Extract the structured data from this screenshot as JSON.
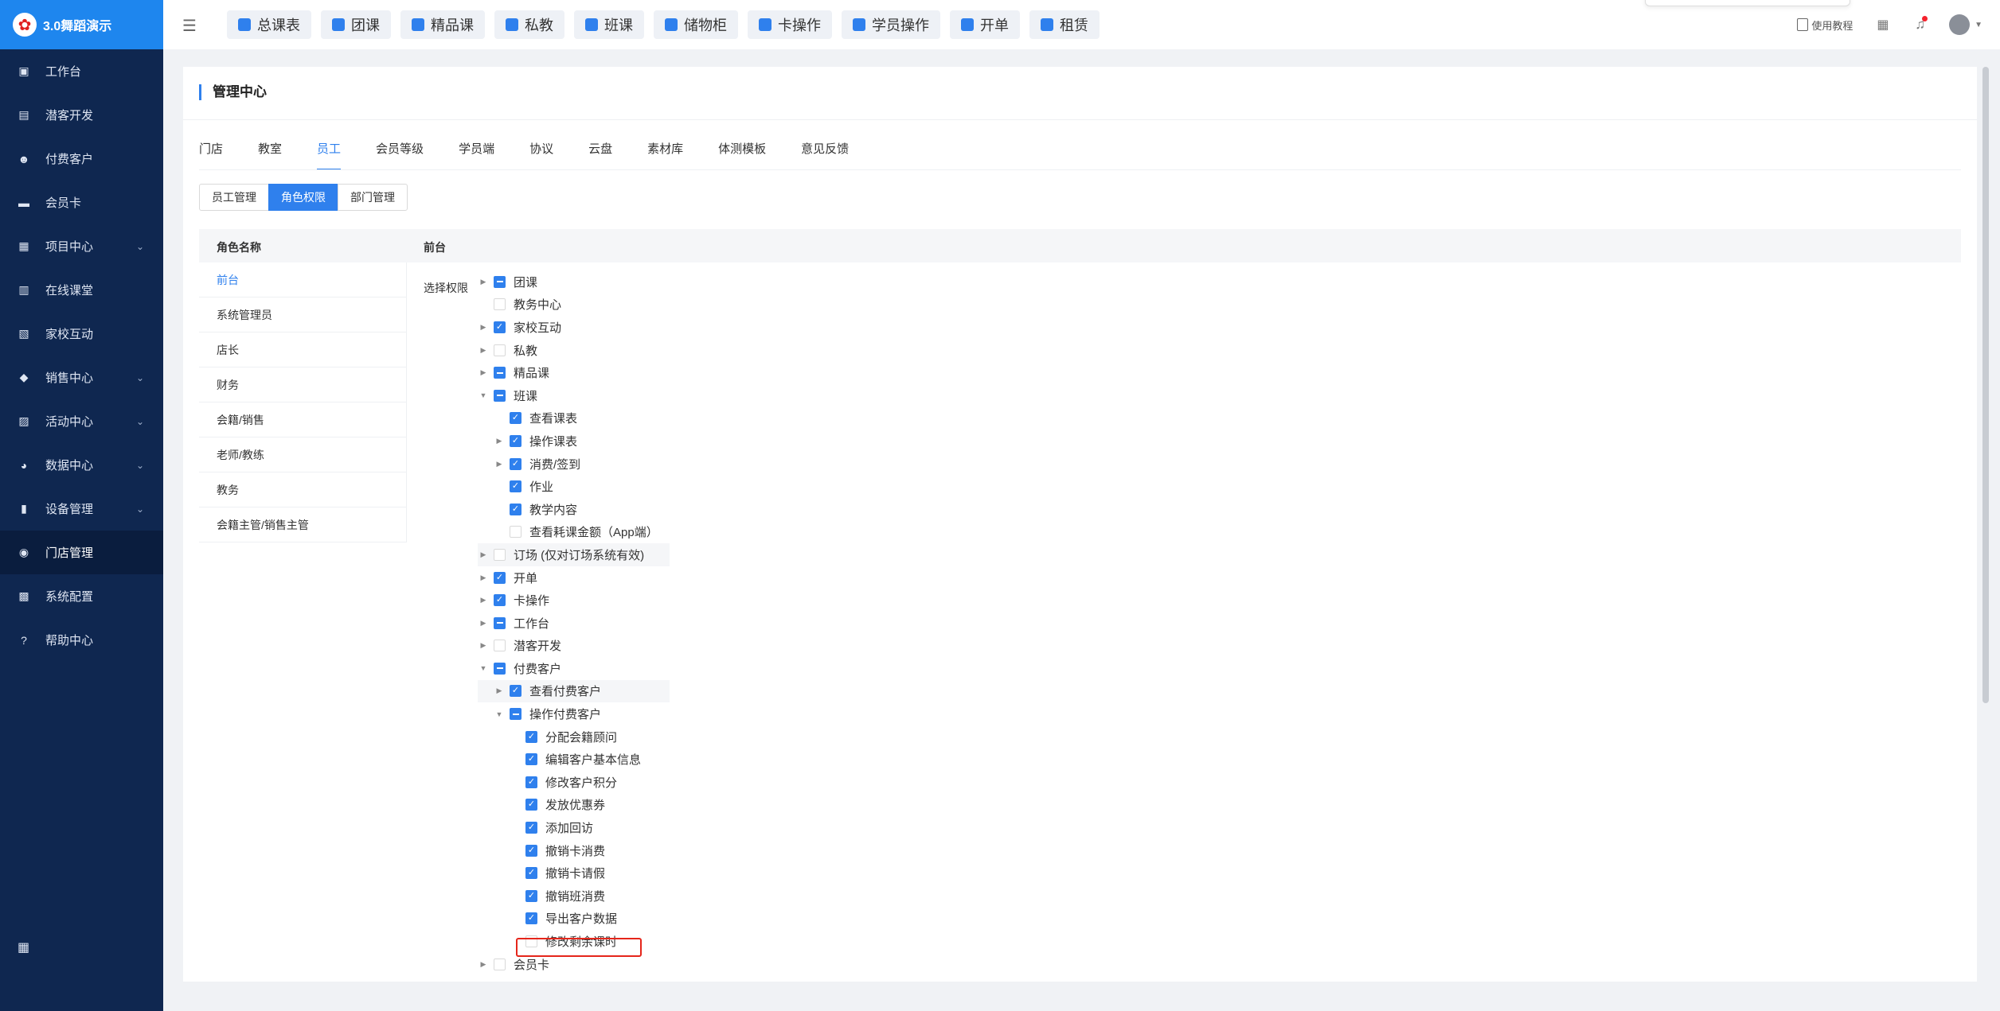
{
  "sidebar": {
    "brand": "3.0舞蹈演示",
    "items": [
      {
        "label": "工作台",
        "icon": "dashboard-icon",
        "glyph": "▣",
        "chev": false,
        "active": false
      },
      {
        "label": "潜客开发",
        "icon": "prospect-icon",
        "glyph": "▤",
        "chev": false,
        "active": false
      },
      {
        "label": "付费客户",
        "icon": "customers-icon",
        "glyph": "☻",
        "chev": false,
        "active": false
      },
      {
        "label": "会员卡",
        "icon": "card-icon",
        "glyph": "▬",
        "chev": false,
        "active": false
      },
      {
        "label": "项目中心",
        "icon": "project-icon",
        "glyph": "▦",
        "chev": true,
        "active": false
      },
      {
        "label": "在线课堂",
        "icon": "classroom-icon",
        "glyph": "▥",
        "chev": false,
        "active": false
      },
      {
        "label": "家校互动",
        "icon": "interaction-icon",
        "glyph": "▧",
        "chev": false,
        "active": false
      },
      {
        "label": "销售中心",
        "icon": "sales-icon",
        "glyph": "◆",
        "chev": true,
        "active": false
      },
      {
        "label": "活动中心",
        "icon": "activity-icon",
        "glyph": "▨",
        "chev": true,
        "active": false
      },
      {
        "label": "数据中心",
        "icon": "data-icon",
        "glyph": "◕",
        "chev": true,
        "active": false
      },
      {
        "label": "设备管理",
        "icon": "device-icon",
        "glyph": "▮",
        "chev": true,
        "active": false
      },
      {
        "label": "门店管理",
        "icon": "store-icon",
        "glyph": "◉",
        "chev": false,
        "active": true
      },
      {
        "label": "系统配置",
        "icon": "settings-icon",
        "glyph": "▩",
        "chev": false,
        "active": false
      },
      {
        "label": "帮助中心",
        "icon": "help-icon",
        "glyph": "?",
        "chev": false,
        "active": false
      }
    ],
    "bottom_icon": "apps-icon"
  },
  "topbar": {
    "quick": [
      "总课表",
      "团课",
      "精品课",
      "私教",
      "班课",
      "储物柜",
      "卡操作",
      "学员操作",
      "开单",
      "租赁"
    ],
    "help": "使用教程"
  },
  "card": {
    "title": "管理中心",
    "tabs": [
      "门店",
      "教室",
      "员工",
      "会员等级",
      "学员端",
      "协议",
      "云盘",
      "素材库",
      "体测模板",
      "意见反馈"
    ],
    "active_tab": 2,
    "segments": [
      "员工管理",
      "角色权限",
      "部门管理"
    ],
    "active_segment": 1
  },
  "roles": {
    "col1": "角色名称",
    "col2": "前台",
    "list": [
      "前台",
      "系统管理员",
      "店长",
      "财务",
      "会籍/销售",
      "老师/教练",
      "教务",
      "会籍主管/销售主管"
    ],
    "active": 0
  },
  "permissions": {
    "label": "选择权限",
    "tree": [
      {
        "label": "团课",
        "level": 0,
        "caret": "right",
        "state": "indet"
      },
      {
        "label": "教务中心",
        "level": 0,
        "caret": "none",
        "state": "off"
      },
      {
        "label": "家校互动",
        "level": 0,
        "caret": "right",
        "state": "on"
      },
      {
        "label": "私教",
        "level": 0,
        "caret": "right",
        "state": "off"
      },
      {
        "label": "精品课",
        "level": 0,
        "caret": "right",
        "state": "indet"
      },
      {
        "label": "班课",
        "level": 0,
        "caret": "down",
        "state": "indet"
      },
      {
        "label": "查看课表",
        "level": 1,
        "caret": "none",
        "state": "on"
      },
      {
        "label": "操作课表",
        "level": 1,
        "caret": "right",
        "state": "on"
      },
      {
        "label": "消费/签到",
        "level": 1,
        "caret": "right",
        "state": "on"
      },
      {
        "label": "作业",
        "level": 1,
        "caret": "none",
        "state": "on"
      },
      {
        "label": "教学内容",
        "level": 1,
        "caret": "none",
        "state": "on"
      },
      {
        "label": "查看耗课金额（App端）",
        "level": 1,
        "caret": "none",
        "state": "off"
      },
      {
        "label": "订场 (仅对订场系统有效)",
        "level": 0,
        "caret": "right",
        "state": "off",
        "hl": true
      },
      {
        "label": "开单",
        "level": 0,
        "caret": "right",
        "state": "on"
      },
      {
        "label": "卡操作",
        "level": 0,
        "caret": "right",
        "state": "on"
      },
      {
        "label": "工作台",
        "level": 0,
        "caret": "right",
        "state": "indet"
      },
      {
        "label": "潜客开发",
        "level": 0,
        "caret": "right",
        "state": "off"
      },
      {
        "label": "付费客户",
        "level": 0,
        "caret": "down",
        "state": "indet"
      },
      {
        "label": "查看付费客户",
        "level": 1,
        "caret": "right",
        "state": "on",
        "hl": true
      },
      {
        "label": "操作付费客户",
        "level": 1,
        "caret": "down",
        "state": "indet"
      },
      {
        "label": "分配会籍顾问",
        "level": 2,
        "caret": "none",
        "state": "on"
      },
      {
        "label": "编辑客户基本信息",
        "level": 2,
        "caret": "none",
        "state": "on"
      },
      {
        "label": "修改客户积分",
        "level": 2,
        "caret": "none",
        "state": "on"
      },
      {
        "label": "发放优惠券",
        "level": 2,
        "caret": "none",
        "state": "on"
      },
      {
        "label": "添加回访",
        "level": 2,
        "caret": "none",
        "state": "on"
      },
      {
        "label": "撤销卡消费",
        "level": 2,
        "caret": "none",
        "state": "on"
      },
      {
        "label": "撤销卡请假",
        "level": 2,
        "caret": "none",
        "state": "on"
      },
      {
        "label": "撤销班消费",
        "level": 2,
        "caret": "none",
        "state": "on"
      },
      {
        "label": "导出客户数据",
        "level": 2,
        "caret": "none",
        "state": "on"
      },
      {
        "label": "修改剩余课时",
        "level": 2,
        "caret": "none",
        "state": "off"
      },
      {
        "label": "会员卡",
        "level": 0,
        "caret": "right",
        "state": "off"
      }
    ]
  },
  "colors": {
    "accent": "#2f80ed",
    "sidebar": "#0f2750",
    "brand": "#1e86ee",
    "highlight_box": "#e5261b"
  }
}
